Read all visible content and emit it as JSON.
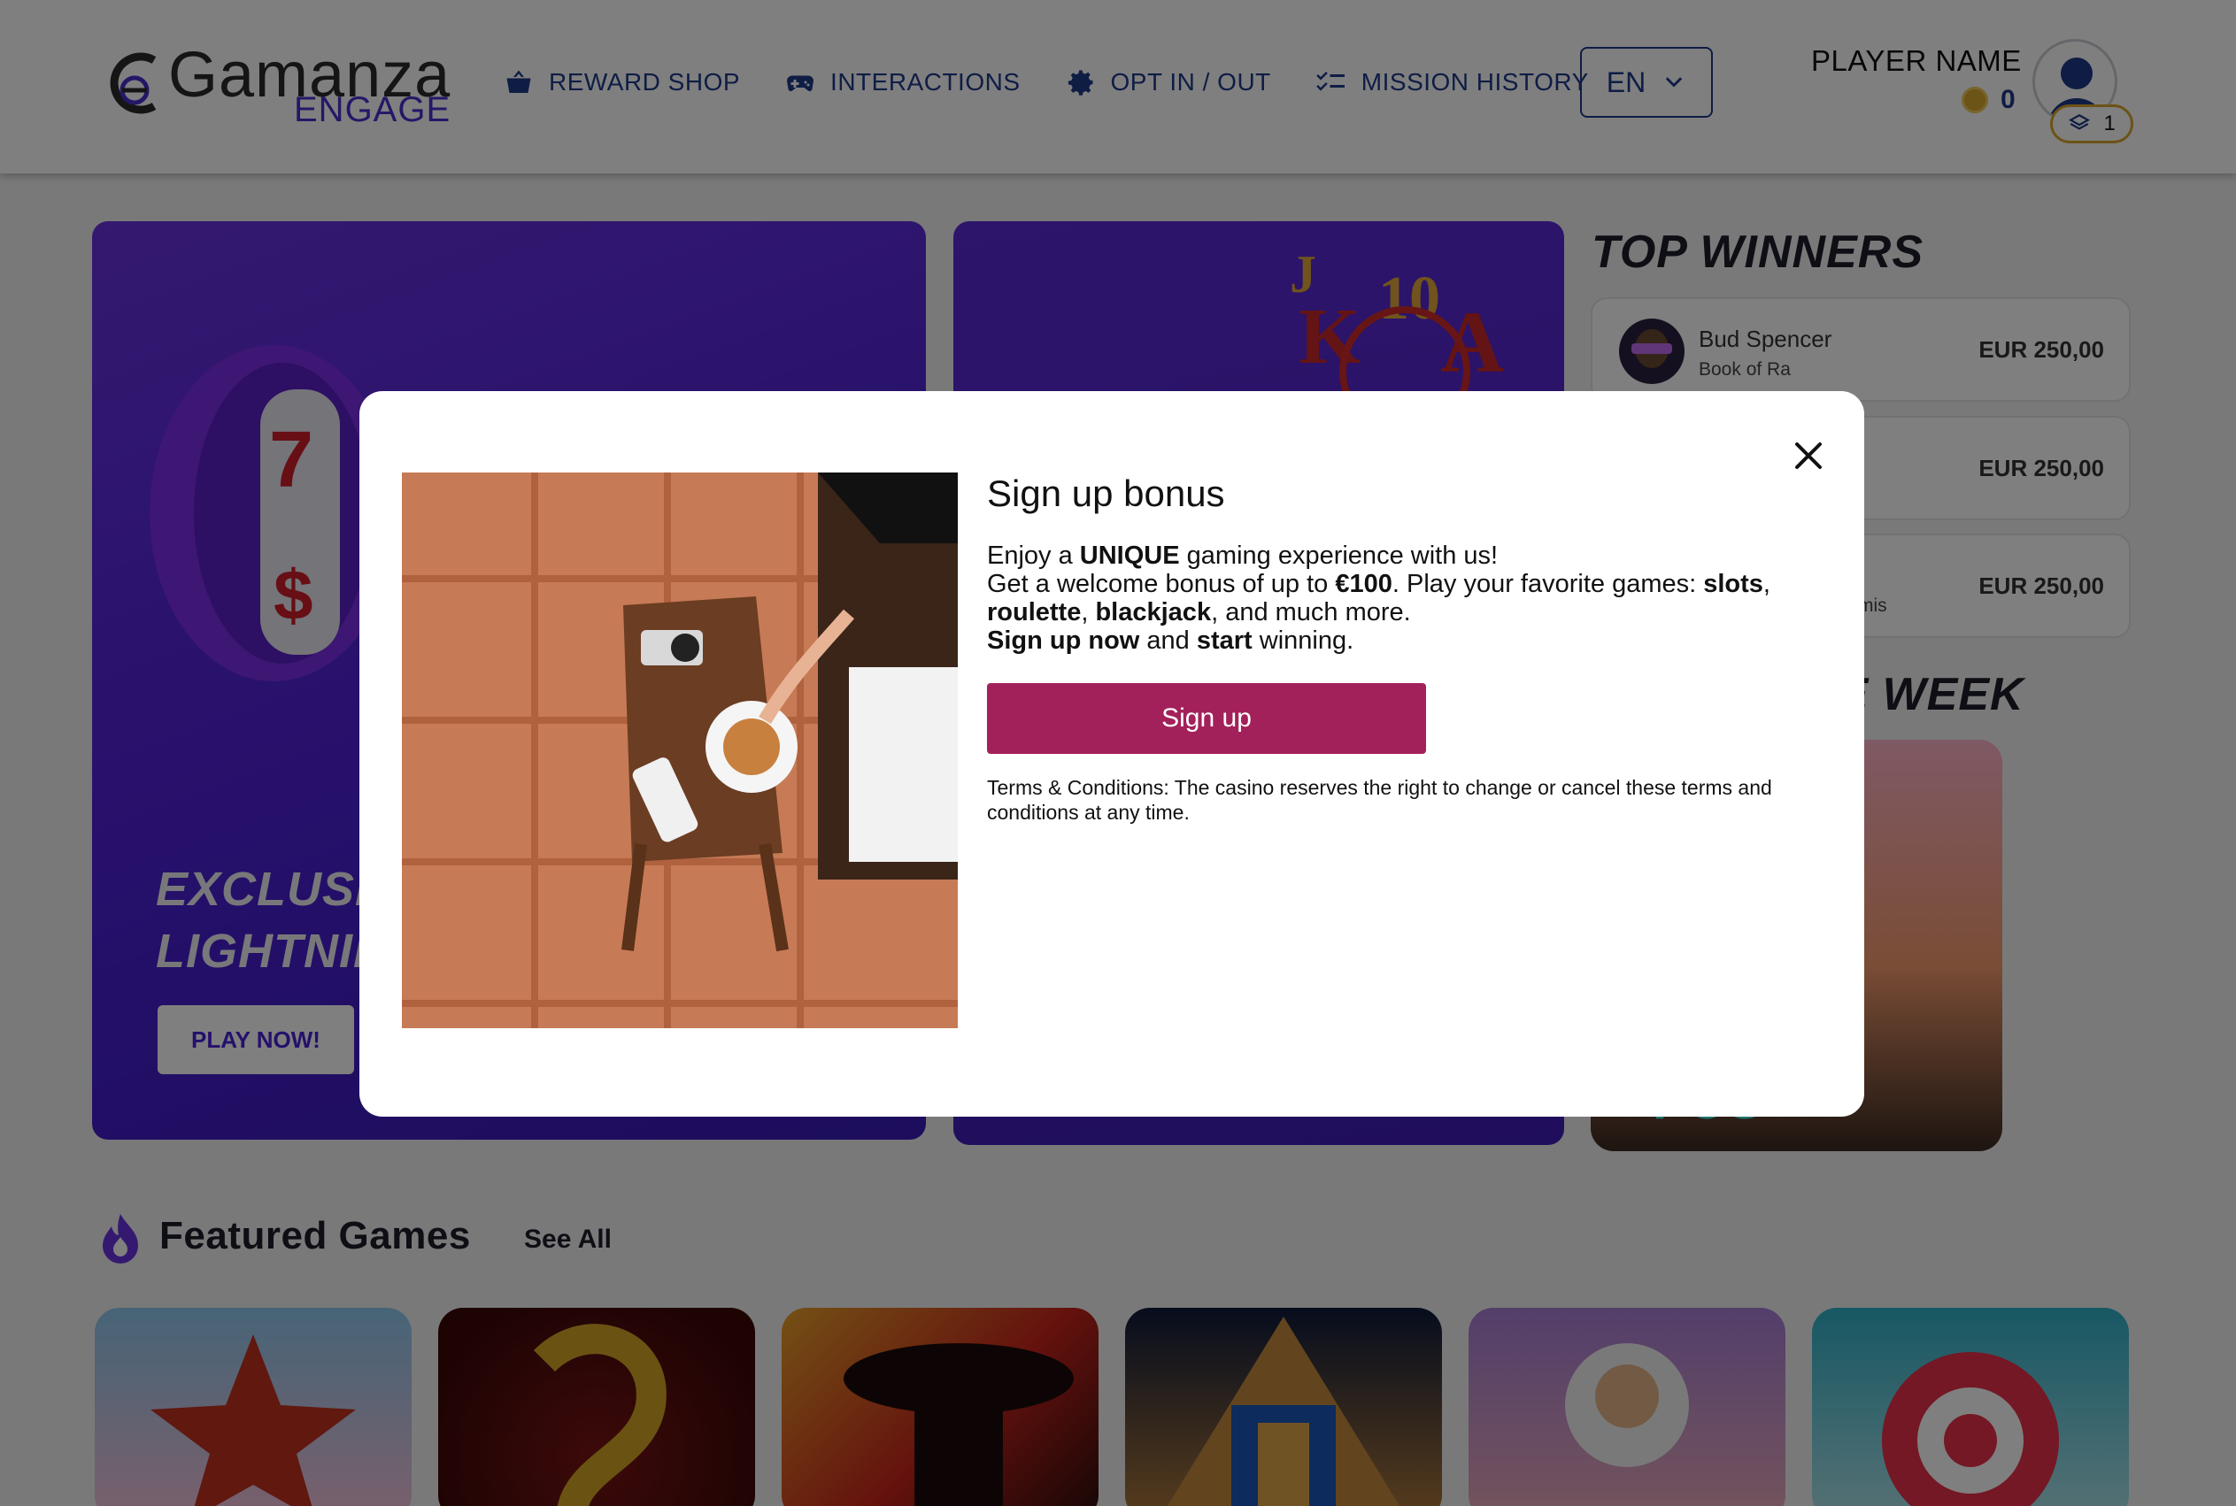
{
  "header": {
    "logo_main": "Gamanza",
    "logo_sub": "ENGAGE",
    "nav": [
      {
        "label": "REWARD SHOP",
        "icon": "basket-icon"
      },
      {
        "label": "INTERACTIONS",
        "icon": "gamepad-icon"
      },
      {
        "label": "OPT IN / OUT",
        "icon": "gear-icon"
      },
      {
        "label": "MISSION HISTORY",
        "icon": "checklist-icon"
      }
    ],
    "language": "EN",
    "player_name": "PLAYER NAME",
    "coins": "0",
    "level": "1"
  },
  "banners": {
    "banner1_title": "EXCLUSIV\nLIGHTNIN",
    "banner1_button": "PLAY NOW!"
  },
  "top_winners": {
    "title": "TOP WINNERS",
    "winners": [
      {
        "name": "Bud Spencer",
        "game": "Book of Ra",
        "amount": "EUR 250,00"
      },
      {
        "name": "",
        "game": "",
        "amount": "EUR 250,00"
      },
      {
        "name": "",
        "game": "mis",
        "amount": "EUR 250,00"
      }
    ]
  },
  "game_of_week": {
    "title": "IE WEEK",
    "card_text": "PUS"
  },
  "featured": {
    "title": "Featured Games",
    "see_all": "See All"
  },
  "modal": {
    "title": "Sign up bonus",
    "line1_pre": "Enjoy a ",
    "line1_bold": "UNIQUE",
    "line1_post": " gaming experience with us!",
    "line2_pre": "Get a welcome bonus of up to ",
    "line2_bold": "€100",
    "line2_mid": ". Play your favorite games: ",
    "line2_slots": "slots",
    "comma1": ",",
    "roulette": "roulette",
    "comma2": ", ",
    "blackjack": "blackjack",
    "line2_end": ", and much more.",
    "line3_bold1": "Sign up now",
    "line3_mid": " and ",
    "line3_bold2": "start",
    "line3_end": " winning.",
    "button": "Sign up",
    "terms": "Terms & Conditions: The casino reserves the right to change or cancel these terms and conditions at any time."
  },
  "colors": {
    "brand_blue": "#1e3a8a",
    "accent_purple": "#4b20d6",
    "signup_button": "#a3215a",
    "coin_gold": "#d9a62c"
  }
}
